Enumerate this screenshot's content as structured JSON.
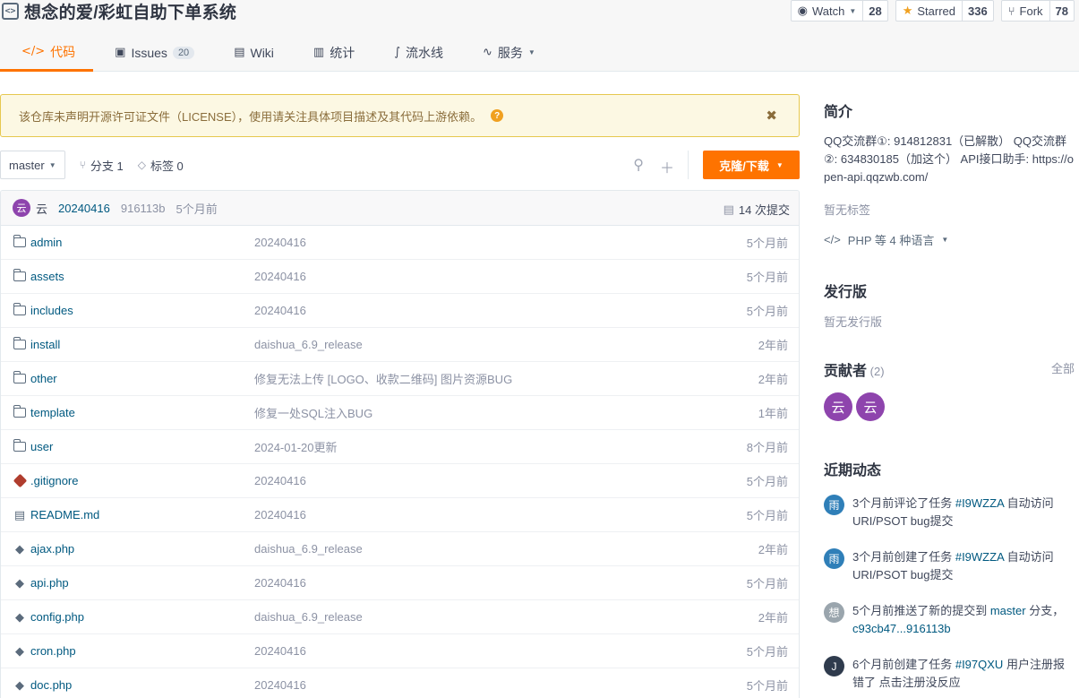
{
  "repo": {
    "title": "想念的爱/彩虹自助下单系统"
  },
  "actions": {
    "watch": {
      "label": "Watch",
      "count": "28"
    },
    "star": {
      "label": "Starred",
      "count": "336"
    },
    "fork": {
      "label": "Fork",
      "count": "78"
    }
  },
  "tabs": [
    {
      "label": "代码",
      "icon": "</>"
    },
    {
      "label": "Issues",
      "badge": "20",
      "icon": "▣"
    },
    {
      "label": "Wiki",
      "icon": "▤"
    },
    {
      "label": "统计",
      "icon": "▥"
    },
    {
      "label": "流水线",
      "icon": "∫"
    },
    {
      "label": "服务",
      "icon": "∿"
    }
  ],
  "notice": {
    "text": "该仓库未声明开源许可证文件（LICENSE），使用请关注具体项目描述及其代码上游依赖。",
    "help": "?",
    "close": "✖"
  },
  "branch": {
    "current": "master",
    "branches": "分支 1",
    "tags": "标签 0",
    "clone": "克隆/下载"
  },
  "commit": {
    "avatar": "云",
    "author": "云",
    "message": "20240416",
    "sha": "916113b",
    "time": "5个月前",
    "count": "14 次提交"
  },
  "files": [
    {
      "name": "admin",
      "type": "folder",
      "commit": "20240416",
      "time": "5个月前"
    },
    {
      "name": "assets",
      "type": "folder",
      "commit": "20240416",
      "time": "5个月前"
    },
    {
      "name": "includes",
      "type": "folder",
      "commit": "20240416",
      "time": "5个月前"
    },
    {
      "name": "install",
      "type": "folder",
      "commit": "daishua_6.9_release",
      "time": "2年前"
    },
    {
      "name": "other",
      "type": "folder",
      "commit": "修复无法上传 [LOGO、收款二维码] 图片资源BUG",
      "time": "2年前"
    },
    {
      "name": "template",
      "type": "folder",
      "commit": "修复一处SQL注入BUG",
      "time": "1年前"
    },
    {
      "name": "user",
      "type": "folder",
      "commit": "2024-01-20更新",
      "time": "8个月前"
    },
    {
      "name": ".gitignore",
      "type": "git",
      "commit": "20240416",
      "time": "5个月前"
    },
    {
      "name": "README.md",
      "type": "readme",
      "commit": "20240416",
      "time": "5个月前"
    },
    {
      "name": "ajax.php",
      "type": "php",
      "commit": "daishua_6.9_release",
      "time": "2年前"
    },
    {
      "name": "api.php",
      "type": "php",
      "commit": "20240416",
      "time": "5个月前"
    },
    {
      "name": "config.php",
      "type": "php",
      "commit": "daishua_6.9_release",
      "time": "2年前"
    },
    {
      "name": "cron.php",
      "type": "php",
      "commit": "20240416",
      "time": "5个月前"
    },
    {
      "name": "doc.php",
      "type": "php",
      "commit": "20240416",
      "time": "5个月前"
    }
  ],
  "sidebar": {
    "intro_title": "简介",
    "intro_text": "QQ交流群①: 914812831（已解散） QQ交流群②: 634830185（加这个） API接口助手: https://open-api.qqzwb.com/",
    "no_tags": "暂无标签",
    "language": "PHP 等 4 种语言",
    "release_title": "发行版",
    "no_release": "暂无发行版",
    "contrib_title": "贡献者",
    "contrib_count": "(2)",
    "contrib_all": "全部",
    "contributors": [
      "云",
      "云"
    ],
    "activity_title": "近期动态",
    "activities": [
      {
        "avatar": "雨",
        "color": "#2f7fb8",
        "pre": "3个月前评论了任务 ",
        "link": "#I9WZZA",
        "post": " 自动访问URI/PSOT bug提交"
      },
      {
        "avatar": "雨",
        "color": "#2f7fb8",
        "pre": "3个月前创建了任务 ",
        "link": "#I9WZZA",
        "post": " 自动访问URI/PSOT bug提交"
      },
      {
        "avatar": "想",
        "color": "#9aa5ad",
        "pre": "5个月前推送了新的提交到 ",
        "link": "master",
        "post": " 分支，",
        "link2": "c93cb47...916113b"
      },
      {
        "avatar": "J",
        "color": "#2f3b4d",
        "pre": "6个月前创建了任务 ",
        "link": "#I97QXU",
        "post": " 用户注册报错了 点击注册没反应"
      }
    ]
  }
}
